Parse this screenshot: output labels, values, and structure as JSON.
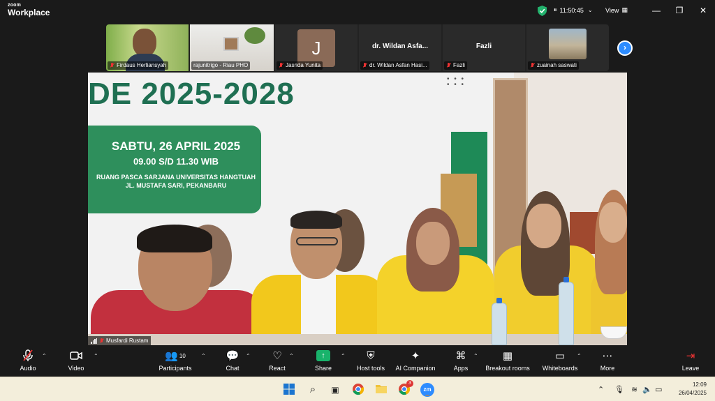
{
  "app": {
    "brand_small": "zoom",
    "brand_big": "Workplace",
    "timer": "11:50:45",
    "view_label": "View"
  },
  "gallery": {
    "tiles": [
      {
        "label": "Firdaus Herliansyah"
      },
      {
        "label": "rajunitrigo - Riau PHO"
      },
      {
        "label": "Jasrida Yunita",
        "avatar_letter": "J"
      },
      {
        "label": "dr. Wildan Asfan Hasi...",
        "display_name": "dr. Wildan Asfa..."
      },
      {
        "label": "Fazli",
        "display_name": "Fazli"
      },
      {
        "label": "zuainah saswati"
      }
    ]
  },
  "video": {
    "period_text": "DE 2025-2028",
    "date_line": "SABTU, 26 APRIL 2025",
    "time_line": "09.00 S/D 11.30 WIB",
    "venue_line": "RUANG PASCA SARJANA UNIVERSITAS HANGTUAH",
    "address_line": "JL. MUSTAFA SARI, PEKANBARU",
    "speaker_name": "Musfardi Rustam"
  },
  "toolbar": {
    "audio": "Audio",
    "video": "Video",
    "participants": "Participants",
    "participants_count": "10",
    "chat": "Chat",
    "react": "React",
    "share": "Share",
    "host_tools": "Host tools",
    "ai_companion": "AI Companion",
    "apps": "Apps",
    "breakout_rooms": "Breakout rooms",
    "whiteboards": "Whiteboards",
    "more": "More",
    "leave": "Leave"
  },
  "taskbar": {
    "time": "12:09",
    "date": "26/04/2025",
    "chrome_badge": "3",
    "zoom_label": "zm"
  },
  "colors": {
    "accent_blue": "#2d8cff",
    "share_green": "#19b36b",
    "leave_red": "#e33333",
    "banner_green": "#2e8f5c"
  }
}
